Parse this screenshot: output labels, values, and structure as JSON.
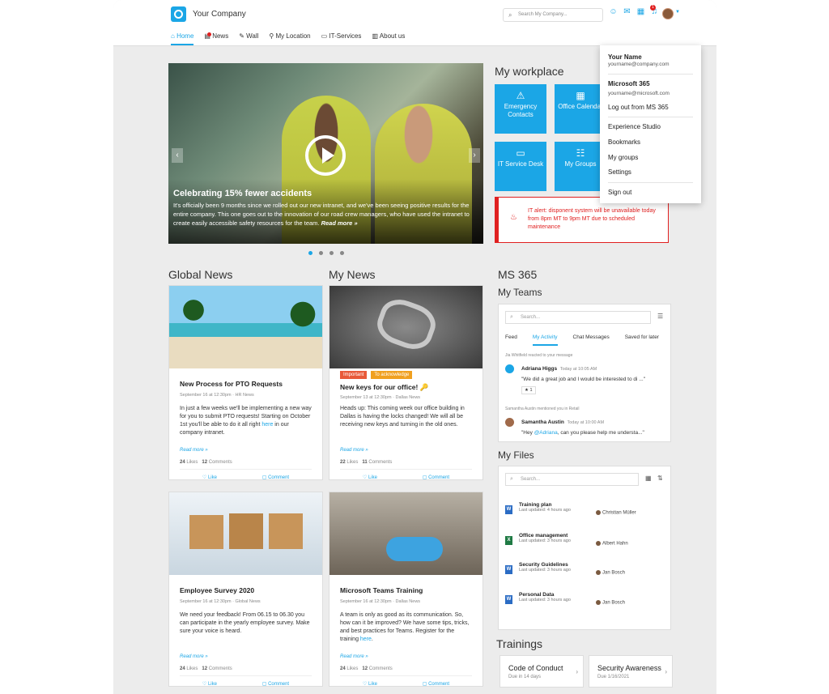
{
  "header": {
    "company": "Your Company",
    "search_placeholder": "Search My Company...",
    "notification_count": "1"
  },
  "nav": [
    {
      "label": "Home"
    },
    {
      "label": "News"
    },
    {
      "label": "Wall"
    },
    {
      "label": "My Location"
    },
    {
      "label": "IT-Services"
    },
    {
      "label": "About us"
    }
  ],
  "hero": {
    "title": "Celebrating 15% fewer accidents",
    "text": "It's officially been 9 months since we rolled out our new intranet, and we've been seeing positive results for the entire company. This one goes out to the innovation of our road crew managers, who have used the intranet to create easily accessible safety resources for the team.",
    "read_more": "Read more »",
    "slides": 4,
    "active_slide": 1
  },
  "workplace": {
    "title": "My workplace",
    "tiles": [
      {
        "label": "Emergency Contacts",
        "icon": "warning-icon"
      },
      {
        "label": "Office Calendar",
        "icon": "calendar-icon"
      },
      {
        "label": "IT Service Desk",
        "icon": "monitor-icon"
      },
      {
        "label": "My Groups",
        "icon": "groups-icon"
      }
    ]
  },
  "alert": {
    "text": "IT alert: disponent system will be unavailable today from 8pm MT to 9pm MT due to scheduled maintenance"
  },
  "global_news": {
    "title": "Global News",
    "cards": [
      {
        "title": "New Process for PTO Requests",
        "meta": "September 16 at 12:30pm · HR News",
        "text": "In just a few weeks we'll be implementing a new way for you to submit PTO requests! Starting on October 1st you'll be able to do it all right ",
        "link": "here",
        "text_after": " in our company intranet.",
        "read_more": "Read more »",
        "likes": "24",
        "likes_label": "Likes",
        "comments": "12",
        "comments_label": "Comments",
        "like": "Like",
        "comment": "Comment"
      },
      {
        "title": "Employee Survey 2020",
        "meta": "September 16 at 12:30pm · Global News",
        "text": "We need your feedback! From 06.15 to 06.30 you can participate in the yearly employee survey. Make sure your voice is heard.",
        "read_more": "Read more »",
        "likes": "24",
        "likes_label": "Likes",
        "comments": "12",
        "comments_label": "Comments",
        "like": "Like",
        "comment": "Comment"
      }
    ]
  },
  "my_news": {
    "title": "My News",
    "cards": [
      {
        "title": "New keys for our office! 🔑",
        "tag1": "Important",
        "tag2": "To acknowledge",
        "meta": "September 13 at 12:30pm · Dallas News",
        "text": "Heads up: This coming week our office building in Dallas is having the locks changed! We will all be receiving new keys and turning in the old ones.",
        "read_more": "Read more »",
        "likes": "22",
        "likes_label": "Likes",
        "comments": "11",
        "comments_label": "Comments",
        "like": "Like",
        "comment": "Comment"
      },
      {
        "title": "Microsoft Teams Training",
        "meta": "September 16 at 12:30pm · Dallas News",
        "text": "A team is only as good as its communication. So, how can it be improved? We have some tips, tricks, and best practices for Teams. Register for the training ",
        "link": "here",
        "text_after": ".",
        "read_more": "Read more »",
        "likes": "24",
        "likes_label": "Likes",
        "comments": "12",
        "comments_label": "Comments",
        "like": "Like",
        "comment": "Comment"
      }
    ]
  },
  "ms365": {
    "title": "MS 365",
    "teams_title": "My Teams",
    "search": "Search...",
    "tabs": [
      "Feed",
      "My Activity",
      "Chat Messages",
      "Saved for later"
    ],
    "activity": [
      {
        "context": "Jia Whitfield reacted to your message",
        "name": "Adriana Higgs",
        "time": "Today at 10:05 AM",
        "message": "\"We did a great job and I would be interested to di ...\"",
        "reaction": "1"
      },
      {
        "context": "Samantha Austin mentioned you in Retail",
        "name": "Samantha Austin",
        "time": "Today at 10:00 AM",
        "message_pre": "\"Hey ",
        "mention": "@Adriana",
        "message_post": ", can you please help me understa...\""
      }
    ]
  },
  "files": {
    "title": "My Files",
    "search": "Search...",
    "items": [
      {
        "name": "Training plan",
        "updated": "Last updated: 4 hours ago",
        "user": "Christian Müller",
        "type": "W",
        "color": "#2b6cc4"
      },
      {
        "name": "Office management",
        "updated": "Last updated: 3 hours ago",
        "user": "Albert Hahn",
        "type": "X",
        "color": "#1f7a44"
      },
      {
        "name": "Security Guidelines",
        "updated": "Last updated: 3 hours ago",
        "user": "Jan Bosch",
        "type": "W",
        "color": "#2b6cc4"
      },
      {
        "name": "Personal Data",
        "updated": "Last updated: 3 hours ago",
        "user": "Jan Bosch",
        "type": "W",
        "color": "#2b6cc4"
      }
    ]
  },
  "trainings": {
    "title": "Trainings",
    "items": [
      {
        "name": "Code of Conduct",
        "due": "Due in 14 days"
      },
      {
        "name": "Security Awareness",
        "due": "Due 1/16/2021"
      }
    ]
  },
  "dropdown": {
    "name": "Your Name",
    "email": "yourname@company.com",
    "ms_title": "Microsoft 365",
    "ms_email": "yourname@microsoft.com",
    "logout_ms": "Log out from MS 365",
    "items": [
      "Experience Studio",
      "Bookmarks",
      "My groups",
      "Settings"
    ],
    "signout": "Sign out"
  },
  "colors": {
    "accent": "#1ba6e6",
    "alert": "#e02020"
  }
}
